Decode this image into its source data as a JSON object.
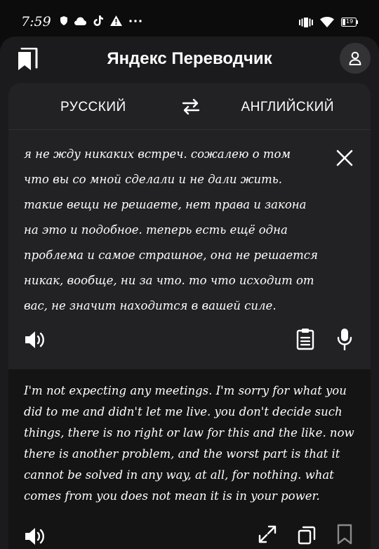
{
  "status_bar": {
    "time": "7:59",
    "icons_left": [
      "shield-icon",
      "cloud-icon",
      "tiktok-icon",
      "warning-icon",
      "more-icon"
    ],
    "icons_right": [
      "vibrate-icon",
      "wifi-icon",
      "battery-icon"
    ],
    "battery_level": "19"
  },
  "header": {
    "title": "Яндекс Переводчик",
    "icons": [
      "bookmarks-icon",
      "profile-icon"
    ]
  },
  "languages": {
    "source": "РУССКИЙ",
    "target": "АНГЛИЙСКИЙ"
  },
  "source_text": "я не жду никаких встреч. сожалею о том что вы со мной сделали и не дали жить. такие вещи не решаете, нет права и закона на это и подобное. теперь есть ещё одна проблема и самое страшное, она не решается никак, вообще, ни за что. то что исходит от вас, не значит находится в вашей силе.",
  "translation_text": "I'm not expecting any meetings. I'm sorry for what you did to me and didn't let me live. you don't decide such things, there is no right or law for this and the like. now there is another problem, and the worst part is that it cannot be solved in any way, at all, for nothing. what comes from you does not mean it is in your power.",
  "colors": {
    "background": "#0c0c0c",
    "app": "#1b1b1d",
    "card": "#222224",
    "result": "#141415",
    "text": "#ffffff"
  }
}
